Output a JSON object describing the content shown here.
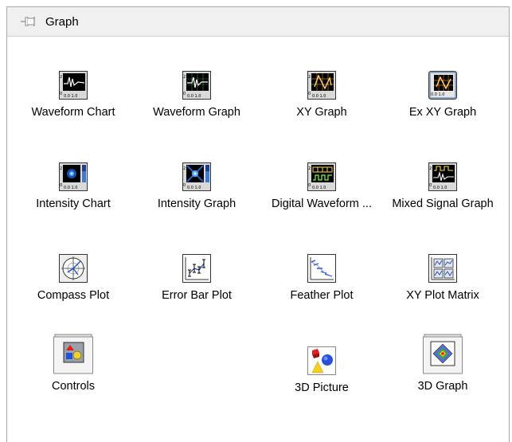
{
  "palette": {
    "title": "Graph",
    "items": [
      {
        "label": "Waveform Chart",
        "icon": "waveform-chart-icon"
      },
      {
        "label": "Waveform Graph",
        "icon": "waveform-graph-icon"
      },
      {
        "label": "XY Graph",
        "icon": "xy-graph-icon"
      },
      {
        "label": "Ex XY Graph",
        "icon": "ex-xy-graph-icon"
      },
      {
        "label": "Intensity Chart",
        "icon": "intensity-chart-icon"
      },
      {
        "label": "Intensity Graph",
        "icon": "intensity-graph-icon"
      },
      {
        "label": "Digital Waveform ...",
        "icon": "digital-waveform-icon"
      },
      {
        "label": "Mixed Signal Graph",
        "icon": "mixed-signal-graph-icon"
      },
      {
        "label": "Compass Plot",
        "icon": "compass-plot-icon"
      },
      {
        "label": "Error Bar Plot",
        "icon": "error-bar-plot-icon"
      },
      {
        "label": "Feather Plot",
        "icon": "feather-plot-icon"
      },
      {
        "label": "XY Plot Matrix",
        "icon": "xy-plot-matrix-icon"
      },
      {
        "label": "Controls",
        "icon": "controls-folder-icon"
      },
      {
        "label": "3D Picture",
        "icon": "3d-picture-icon"
      },
      {
        "label": "3D Graph",
        "icon": "3d-graph-icon"
      }
    ]
  }
}
